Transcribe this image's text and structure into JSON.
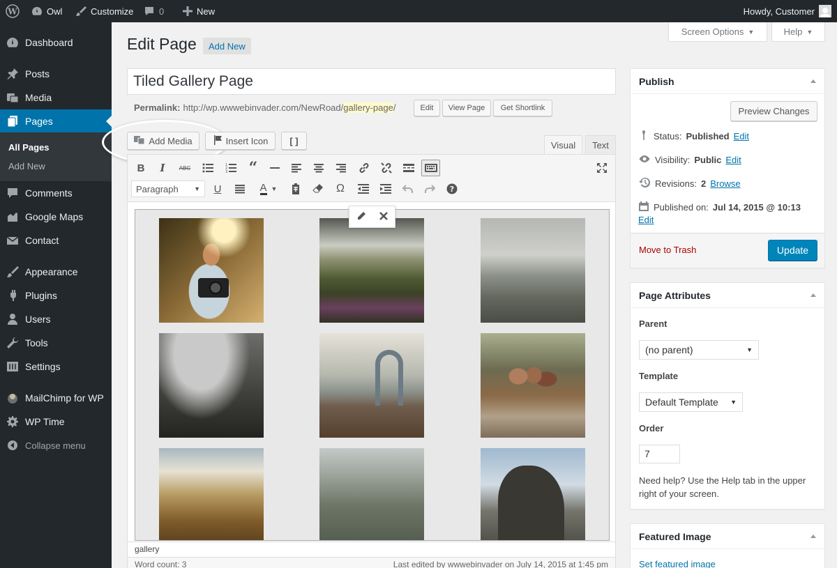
{
  "adminbar": {
    "site": "Owl",
    "customize": "Customize",
    "comments": "0",
    "new": "New",
    "howdy": "Howdy, Customer"
  },
  "menu": {
    "dashboard": "Dashboard",
    "posts": "Posts",
    "media": "Media",
    "pages": "Pages",
    "all_pages": "All Pages",
    "add_new": "Add New",
    "comments": "Comments",
    "google_maps": "Google Maps",
    "contact": "Contact",
    "appearance": "Appearance",
    "plugins": "Plugins",
    "users": "Users",
    "tools": "Tools",
    "settings": "Settings",
    "mailchimp": "MailChimp for WP",
    "wptime": "WP Time",
    "collapse": "Collapse menu"
  },
  "screen_options": "Screen Options",
  "help": "Help",
  "heading": "Edit Page",
  "add_new_btn": "Add New",
  "title_value": "Tiled Gallery Page",
  "permalink": {
    "label": "Permalink:",
    "base": "http://wp.wwwebinvader.com/NewRoad/",
    "slug": "gallery-page",
    "tail": "/",
    "edit": "Edit",
    "view": "View Page",
    "shortlink": "Get Shortlink"
  },
  "editor": {
    "add_media": "Add Media",
    "insert_icon": "Insert Icon",
    "shortcode": "[ ]",
    "tab_visual": "Visual",
    "tab_text": "Text",
    "format": "Paragraph",
    "path": "gallery",
    "word_count": "Word count: 3",
    "last_edited": "Last edited by wwwebinvader on July 14, 2015 at 1:45 pm"
  },
  "publish": {
    "title": "Publish",
    "preview": "Preview Changes",
    "status_label": "Status:",
    "status_value": "Published",
    "visibility_label": "Visibility:",
    "visibility_value": "Public",
    "revisions_label": "Revisions:",
    "revisions_value": "2",
    "browse": "Browse",
    "published_label": "Published on:",
    "published_value": "Jul 14, 2015 @ 10:13",
    "edit": "Edit",
    "trash": "Move to Trash",
    "update": "Update"
  },
  "attributes": {
    "title": "Page Attributes",
    "parent_label": "Parent",
    "parent_value": "(no parent)",
    "template_label": "Template",
    "template_value": "Default Template",
    "order_label": "Order",
    "order_value": "7",
    "help": "Need help? Use the Help tab in the upper right of your screen."
  },
  "featured": {
    "title": "Featured Image",
    "link": "Set featured image"
  },
  "colors": {
    "accent": "#0073aa",
    "adminbar": "#23282d",
    "update": "#0085ba",
    "trash": "#a00"
  }
}
